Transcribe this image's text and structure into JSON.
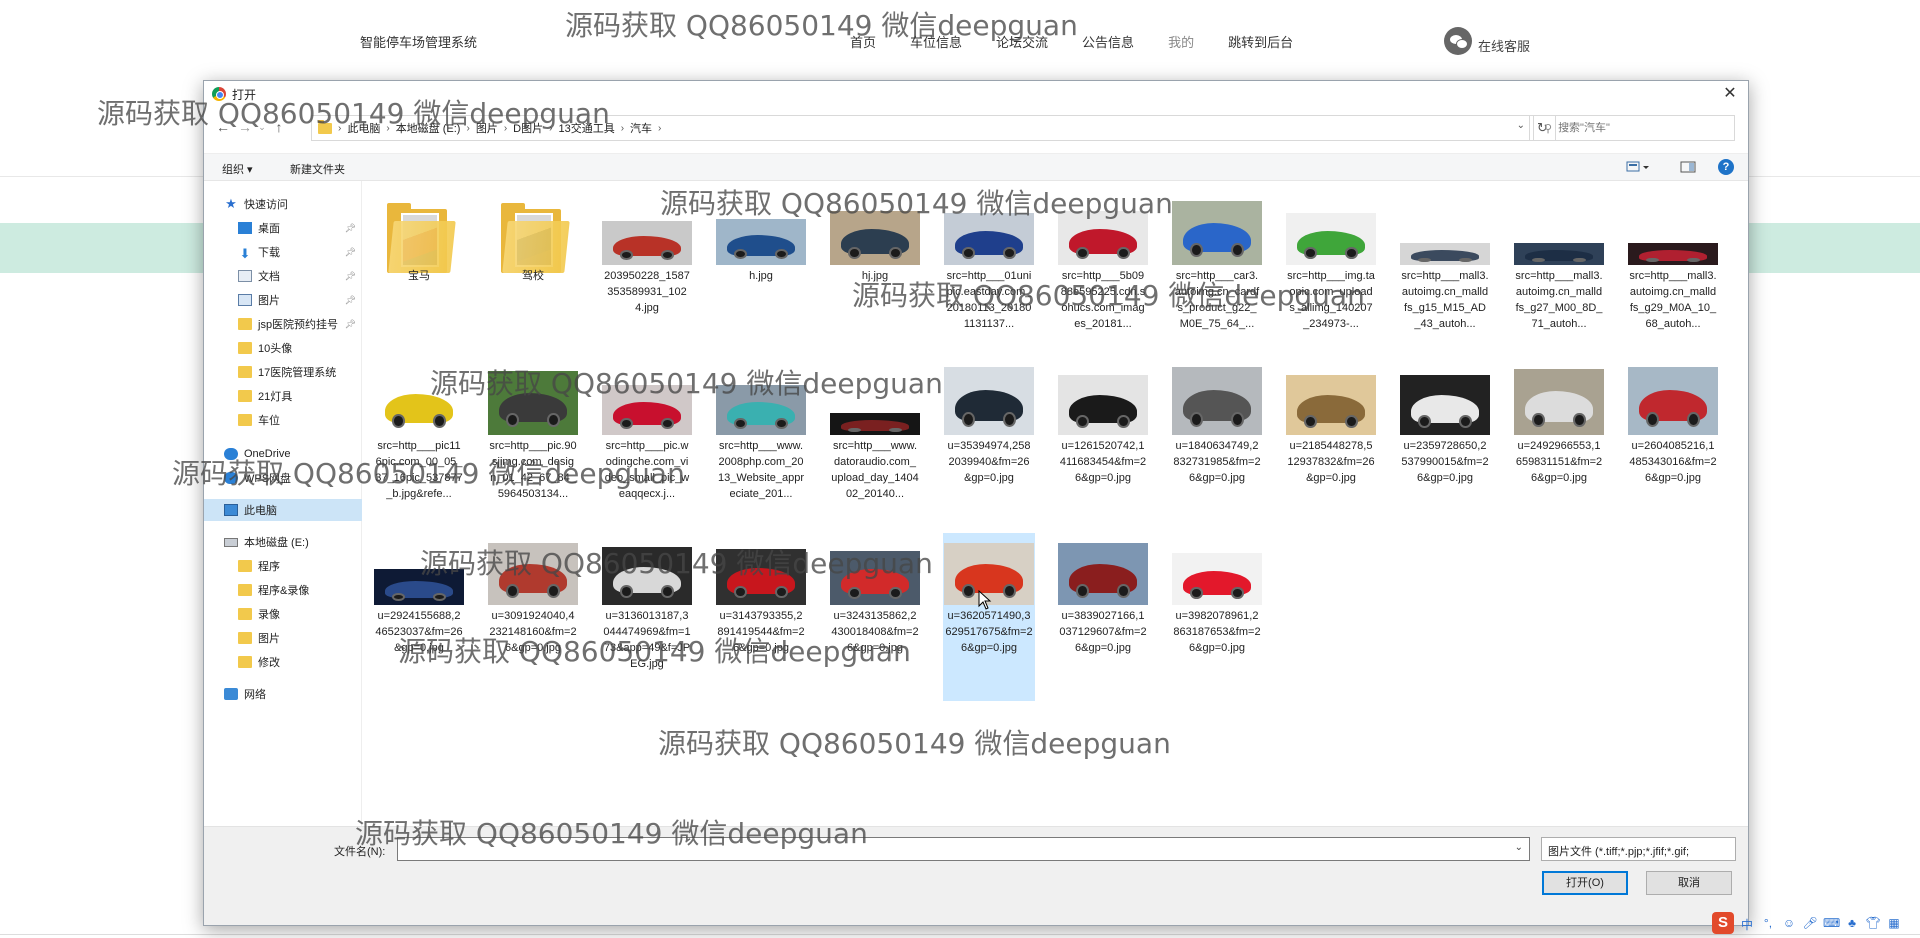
{
  "site": {
    "brand": "智能停车场管理系统",
    "nav": [
      "首页",
      "车位信息",
      "论坛交流",
      "公告信息",
      "我的",
      "跳转到后台"
    ],
    "service": "在线客服"
  },
  "watermark": "源码获取 QQ86050149 微信deepguan",
  "dialog": {
    "title": "打开",
    "breadcrumbs": [
      "此电脑",
      "本地磁盘 (E:)",
      "图片",
      "D图片",
      "13交通工具",
      "汽车"
    ],
    "search_placeholder": "搜索\"汽车\"",
    "toolbar": {
      "organize": "组织 ▾",
      "new_folder": "新建文件夹"
    },
    "nav_items": [
      {
        "label": "快速访问",
        "icon": "star-icon",
        "pinned": false
      },
      {
        "label": "桌面",
        "icon": "desktop-icon",
        "pinned": true
      },
      {
        "label": "下载",
        "icon": "download-icon",
        "pinned": true
      },
      {
        "label": "文档",
        "icon": "document-icon",
        "pinned": true
      },
      {
        "label": "图片",
        "icon": "pictures-icon",
        "pinned": true
      },
      {
        "label": "jsp医院预约挂号",
        "icon": "folder-icon",
        "pinned": true
      },
      {
        "label": "10头像",
        "icon": "folder-icon",
        "pinned": false
      },
      {
        "label": "17医院管理系统",
        "icon": "folder-icon",
        "pinned": false
      },
      {
        "label": "21灯具",
        "icon": "folder-icon",
        "pinned": false
      },
      {
        "label": "车位",
        "icon": "folder-icon",
        "pinned": false
      },
      {
        "label": "OneDrive",
        "icon": "cloud-icon",
        "pinned": false
      },
      {
        "label": "WPS网盘",
        "icon": "cloud-icon",
        "pinned": false
      },
      {
        "label": "此电脑",
        "icon": "computer-icon",
        "pinned": false
      },
      {
        "label": "本地磁盘 (E:)",
        "icon": "drive-icon",
        "pinned": false
      },
      {
        "label": "程序",
        "icon": "folder-icon",
        "pinned": false
      },
      {
        "label": "程序&录像",
        "icon": "folder-icon",
        "pinned": false
      },
      {
        "label": "录像",
        "icon": "folder-icon",
        "pinned": false
      },
      {
        "label": "图片",
        "icon": "folder-icon",
        "pinned": false
      },
      {
        "label": "修改",
        "icon": "folder-icon",
        "pinned": false
      },
      {
        "label": "网络",
        "icon": "network-icon",
        "pinned": false
      }
    ],
    "files": [
      {
        "name": "宝马",
        "kind": "folder",
        "color": "#c0392b"
      },
      {
        "name": "驾校",
        "kind": "folder",
        "color": "#34495e"
      },
      {
        "name": "203950228_1587353589931_1024.jpg",
        "kind": "image",
        "color": "#b83227",
        "bg": "#c9c9c9"
      },
      {
        "name": "h.jpg",
        "kind": "image",
        "color": "#1f4e8c",
        "bg": "#9fb6c9"
      },
      {
        "name": "hj.jpg",
        "kind": "image",
        "color": "#2c3e50",
        "bg": "#b7a58a"
      },
      {
        "name": "src=http___01unipic.eastday.com_20180113_201801131137...",
        "kind": "image",
        "color": "#1f3f8c",
        "bg": "#c4ccd6"
      },
      {
        "name": "src=http___5b0988e595225.cdn.sohucs.com_images_20181...",
        "kind": "image",
        "color": "#c0182b",
        "bg": "#e8e8e8"
      },
      {
        "name": "src=http___car3.autoimg.cn_cardfs_product_g22_M0E_75_64_...",
        "kind": "image",
        "color": "#2a66c9",
        "bg": "#aab3a0"
      },
      {
        "name": "src=http___img.taopic.com_uploads_allimg_140207_234973-...",
        "kind": "image",
        "color": "#3fa63a",
        "bg": "#f0f0f0"
      },
      {
        "name": "src=http___mall3.autoimg.cn_malldfs_g15_M15_AD_43_autoh...",
        "kind": "image",
        "color": "#3b4a5e",
        "bg": "#d6d6d6"
      },
      {
        "name": "src=http___mall3.autoimg.cn_malldfs_g27_M00_8D_71_autoh...",
        "kind": "image",
        "color": "#1d2e45",
        "bg": "#2f4158"
      },
      {
        "name": "src=http___mall3.autoimg.cn_malldfs_g29_M0A_10_68_autoh...",
        "kind": "image",
        "color": "#b02030",
        "bg": "#2a1a1d"
      },
      {
        "name": "src=http___pic116pic.com_00_05_37_16pic_537877_b.jpg&refe...",
        "kind": "image",
        "color": "#e3c41a",
        "bg": "#ffffff"
      },
      {
        "name": "src=http___pic.90sjimg.com_design_01_42_67_84_5964503134...",
        "kind": "image",
        "color": "#3a3a3a",
        "bg": "#4d7a3a"
      },
      {
        "name": "src=http___pic.wodingche.com_video_small_pic_weaqqecx.j...",
        "kind": "image",
        "color": "#c8102e",
        "bg": "#d0c8c8"
      },
      {
        "name": "src=http___www.2008php.com_2013_Website_appreciate_201...",
        "kind": "image",
        "color": "#3ab0b0",
        "bg": "#8a9aa8"
      },
      {
        "name": "src=http___www.datoraudio.com_upload_day_140402_20140...",
        "kind": "image",
        "color": "#7a2020",
        "bg": "#151515"
      },
      {
        "name": "u=35394974,2582039940&fm=26&gp=0.jpg",
        "kind": "image",
        "color": "#1f2a36",
        "bg": "#d7dde3"
      },
      {
        "name": "u=1261520742,1411683454&fm=26&gp=0.jpg",
        "kind": "image",
        "color": "#1a1a1a",
        "bg": "#e4e4e4"
      },
      {
        "name": "u=1840634749,2832731985&fm=26&gp=0.jpg",
        "kind": "image",
        "color": "#555555",
        "bg": "#b5b9bd"
      },
      {
        "name": "u=2185448278,512937832&fm=26&gp=0.jpg",
        "kind": "image",
        "color": "#8a6a3a",
        "bg": "#e0c89a"
      },
      {
        "name": "u=2359728650,2537990015&fm=26&gp=0.jpg",
        "kind": "image",
        "color": "#e8e8e8",
        "bg": "#222222"
      },
      {
        "name": "u=2492966553,1659831151&fm=26&gp=0.jpg",
        "kind": "image",
        "color": "#dcdcdc",
        "bg": "#a9a291"
      },
      {
        "name": "u=2604085216,1485343016&fm=26&gp=0.jpg",
        "kind": "image",
        "color": "#c0282e",
        "bg": "#a7b8c6"
      },
      {
        "name": "u=2924155688,246523037&fm=26&gp=0.jpg",
        "kind": "image",
        "color": "#2a4a8a",
        "bg": "#0e1a35"
      },
      {
        "name": "u=3091924040,4232148160&fm=26&gp=0.jpg",
        "kind": "image",
        "color": "#b03a2e",
        "bg": "#c7c2bd"
      },
      {
        "name": "u=3136013187,3044474969&fm=173&app=49&f=JPEG.jpg",
        "kind": "image",
        "color": "#d8d8d8",
        "bg": "#2a2a2a"
      },
      {
        "name": "u=3143793355,2891419544&fm=26&gp=0.jpg",
        "kind": "image",
        "color": "#c8161d",
        "bg": "#303030"
      },
      {
        "name": "u=3243135862,2430018408&fm=26&gp=0.jpg",
        "kind": "image",
        "color": "#d22a2a",
        "bg": "#4c5a6a"
      },
      {
        "name": "u=3620571490,3629517675&fm=26&gp=0.jpg",
        "kind": "image",
        "color": "#d8361e",
        "bg": "#d7d0c5",
        "selected": true
      },
      {
        "name": "u=3839027166,1037129607&fm=26&gp=0.jpg",
        "kind": "image",
        "color": "#8a1e1e",
        "bg": "#7d96b2"
      },
      {
        "name": "u=3982078961,2863187653&fm=26&gp=0.jpg",
        "kind": "image",
        "color": "#e3182b",
        "bg": "#f2f2f2"
      }
    ],
    "filename_label": "文件名(N):",
    "filename_value": "",
    "filetype": "图片文件 (*.tiff;*.pjp;*.jfif;*.gif;",
    "open_button": "打开(O)",
    "cancel_button": "取消"
  }
}
